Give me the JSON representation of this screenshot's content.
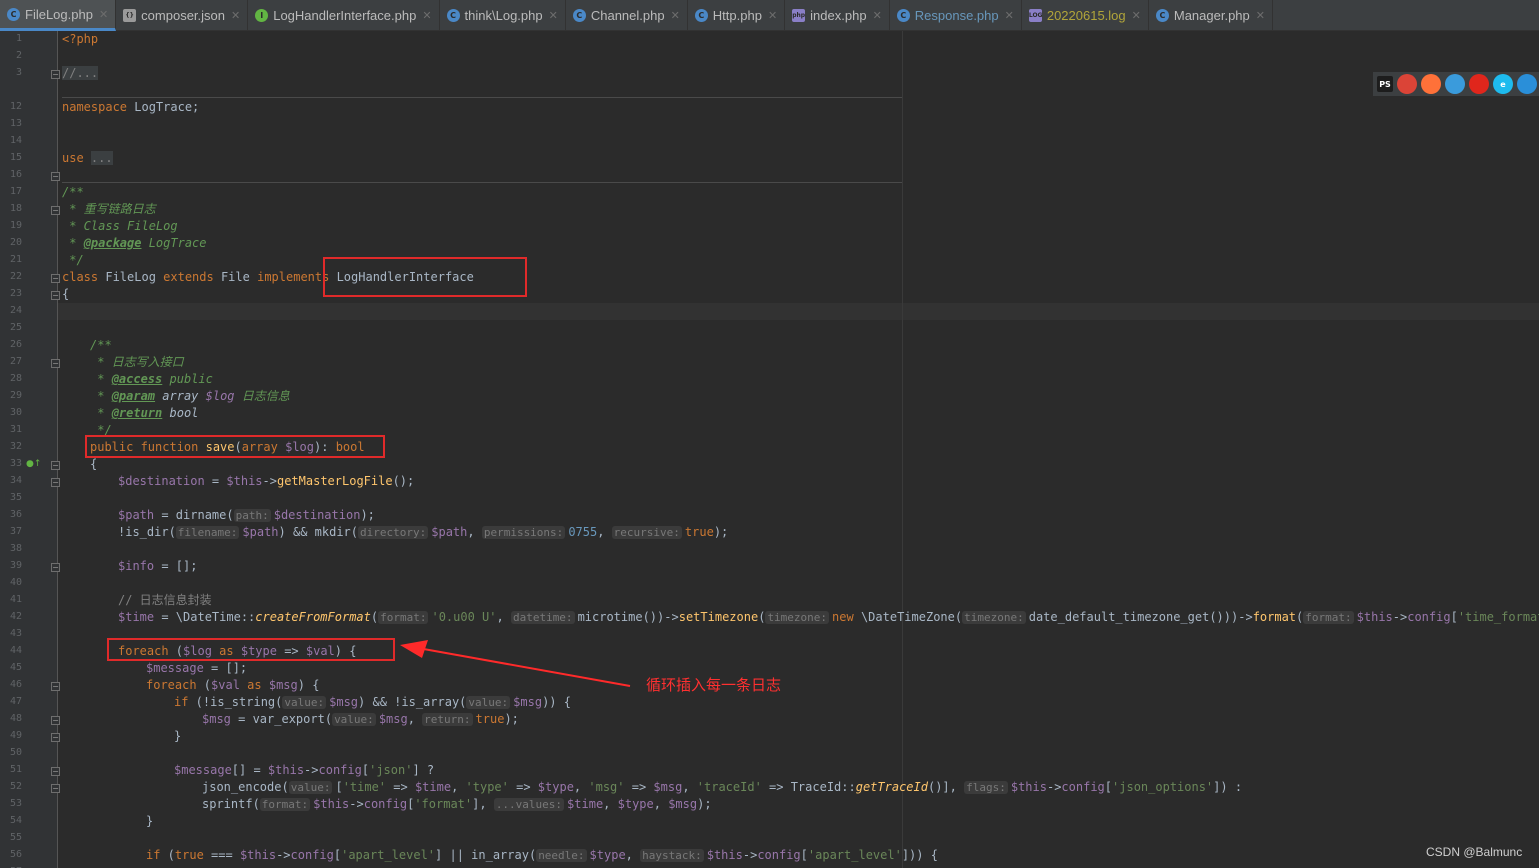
{
  "tabs": [
    {
      "label": "FileLog.php",
      "icon": "php-class-icon",
      "color": "#4a88c7",
      "glyph": "C",
      "active": true
    },
    {
      "label": "composer.json",
      "icon": "json-file-icon",
      "color": "#9a9a9a",
      "glyph": "{}",
      "active": false
    },
    {
      "label": "LogHandlerInterface.php",
      "icon": "php-interface-icon",
      "color": "#62b543",
      "glyph": "I",
      "active": false
    },
    {
      "label": "think\\Log.php",
      "icon": "php-class-icon",
      "color": "#4a88c7",
      "glyph": "C",
      "active": false
    },
    {
      "label": "Channel.php",
      "icon": "php-class-icon",
      "color": "#4a88c7",
      "glyph": "C",
      "active": false
    },
    {
      "label": "Http.php",
      "icon": "php-class-icon",
      "color": "#4a88c7",
      "glyph": "C",
      "active": false
    },
    {
      "label": "index.php",
      "icon": "php-file-icon",
      "color": "#8a7fc7",
      "glyph": "php",
      "active": false
    },
    {
      "label": "Response.php",
      "icon": "php-class-icon",
      "color": "#4a88c7",
      "glyph": "C",
      "active": false,
      "textColor": "#6897bb"
    },
    {
      "label": "20220615.log",
      "icon": "log-file-icon",
      "color": "#8a7fc7",
      "glyph": "LOG",
      "active": false,
      "textColor": "#b1a53a"
    },
    {
      "label": "Manager.php",
      "icon": "php-class-icon",
      "color": "#4a88c7",
      "glyph": "C",
      "active": false
    }
  ],
  "gutter": {
    "line_numbers": [
      "1",
      "2",
      "3",
      "12",
      "13",
      "14",
      "15",
      "16",
      "17",
      "18",
      "19",
      "20",
      "21",
      "22",
      "23",
      "24",
      "25",
      "26",
      "27",
      "28",
      "29",
      "30",
      "31",
      "32",
      "33",
      "34",
      "35",
      "36",
      "37",
      "38",
      "39",
      "40",
      "41",
      "42",
      "43",
      "44",
      "45",
      "46",
      "47",
      "48",
      "49",
      "50",
      "51",
      "52",
      "53",
      "54",
      "55",
      "56",
      "57",
      "58"
    ]
  },
  "code": {
    "l1": "<?php",
    "l3": "//...",
    "l13_kw": "namespace",
    "l13_rest": " LogTrace;",
    "l16_kw": "use",
    "l16_ph": "...",
    "l19": "/**",
    "l20": " * 重写链路日志",
    "l21": " * Class FileLog",
    "l22_a": " * ",
    "l22_tag": "@package",
    "l22_b": " LogTrace",
    "l23": " */",
    "l24_kw1": "class",
    "l24_a": " FileLog ",
    "l24_kw2": "extends",
    "l24_b": " File ",
    "l24_kw3": "implements",
    "l24_c": " LogHandlerInterface",
    "l25": "{",
    "l28": "/**",
    "l29": " * 日志写入接口",
    "l30_a": " * ",
    "l30_tag": "@access",
    "l30_b": " public",
    "l31_a": " * ",
    "l31_tag": "@param",
    "l31_b": " array ",
    "l31_var": "$log",
    "l31_c": " 日志信息",
    "l32_a": " * ",
    "l32_tag": "@return",
    "l32_b": " bool",
    "l33": " */",
    "l34_kw1": "public function ",
    "l34_fn": "save",
    "l34_a": "(",
    "l34_kw2": "array ",
    "l34_var": "$log",
    "l34_b": "): ",
    "l34_kw3": "bool",
    "l35": "{",
    "l36_var": "$destination",
    "l36_a": " = ",
    "l36_this": "$this",
    "l36_b": "->",
    "l36_fn": "getMasterLogFile",
    "l36_c": "();",
    "l38_var": "$path",
    "l38_a": " = dirname(",
    "l38_h": "path:",
    "l38_var2": "$destination",
    "l38_b": ");",
    "l39_a": "!is_dir(",
    "l39_h1": "filename:",
    "l39_v1": "$path",
    "l39_b": ") && mkdir(",
    "l39_h2": "directory:",
    "l39_v2": "$path",
    "l39_c": ", ",
    "l39_h3": "permissions:",
    "l39_num": "0755",
    "l39_d": ", ",
    "l39_h4": "recursive:",
    "l39_kw": "true",
    "l39_e": ");",
    "l41_var": "$info",
    "l41_a": " = [];",
    "l43": "// 日志信息封装",
    "l44_var": "$time",
    "l44_a": " = \\DateTime::",
    "l44_fn": "createFromFormat",
    "l44_b": "(",
    "l44_h1": "format:",
    "l44_s1": "'0.u00 U'",
    "l44_c": ", ",
    "l44_h2": "datetime:",
    "l44_d": "microtime())->",
    "l44_fn2": "setTimezone",
    "l44_e": "(",
    "l44_h3": "timezone:",
    "l44_kw": "new",
    "l44_f": " \\DateTimeZone(",
    "l44_h4": "timezone:",
    "l44_g": "date_default_timezone_get()))->",
    "l44_fn3": "format",
    "l44_h": "(",
    "l44_h5": "format:",
    "l44_this": "$this",
    "l44_i": "->",
    "l44_cfg": "config",
    "l44_j": "[",
    "l44_s2": "'time_format'",
    "l44_k": "]);",
    "l46_kw": "foreach",
    "l46_a": " (",
    "l46_v1": "$log",
    "l46_kw2": " as ",
    "l46_v2": "$type",
    "l46_b": " => ",
    "l46_v3": "$val",
    "l46_c": ") {",
    "l47_var": "$message",
    "l47_a": " = [];",
    "l48_kw": "foreach",
    "l48_a": " (",
    "l48_v1": "$val",
    "l48_kw2": " as ",
    "l48_v2": "$msg",
    "l48_b": ") {",
    "l49_kw": "if",
    "l49_a": " (!is_string(",
    "l49_h1": "value:",
    "l49_v1": "$msg",
    "l49_b": ") && !is_array(",
    "l49_h2": "value:",
    "l49_v2": "$msg",
    "l49_c": ")) {",
    "l50_var": "$msg",
    "l50_a": " = var_export(",
    "l50_h1": "value:",
    "l50_v2": "$msg",
    "l50_b": ", ",
    "l50_h2": "return:",
    "l50_kw": "true",
    "l50_c": ");",
    "l51": "}",
    "l53_var": "$message",
    "l53_a": "[] = ",
    "l53_this": "$this",
    "l53_b": "->",
    "l53_cfg": "config",
    "l53_c": "[",
    "l53_s": "'json'",
    "l53_d": "] ?",
    "l54_a": "json_encode(",
    "l54_h1": "value:",
    "l54_b": "[",
    "l54_s1": "'time'",
    "l54_c": " => ",
    "l54_v1": "$time",
    "l54_d": ", ",
    "l54_s2": "'type'",
    "l54_e": " => ",
    "l54_v2": "$type",
    "l54_f": ", ",
    "l54_s3": "'msg'",
    "l54_g": " => ",
    "l54_v3": "$msg",
    "l54_h": ", ",
    "l54_s4": "'traceId'",
    "l54_i": " => TraceId::",
    "l54_fn": "getTraceId",
    "l54_j": "()], ",
    "l54_h2": "flags:",
    "l54_this": "$this",
    "l54_k": "->",
    "l54_cfg": "config",
    "l54_l": "[",
    "l54_s5": "'json_options'",
    "l54_m": "]) :",
    "l55_a": "sprintf(",
    "l55_h1": "format:",
    "l55_this": "$this",
    "l55_b": "->",
    "l55_cfg": "config",
    "l55_c": "[",
    "l55_s": "'format'",
    "l55_d": "], ",
    "l55_h2": "...values:",
    "l55_v1": "$time",
    "l55_e": ", ",
    "l55_v2": "$type",
    "l55_f": ", ",
    "l55_v3": "$msg",
    "l55_g": ");",
    "l56": "}",
    "l58_kw": "if",
    "l58_a": " (",
    "l58_kw2": "true",
    "l58_b": " === ",
    "l58_this": "$this",
    "l58_c": "->",
    "l58_cfg": "config",
    "l58_d": "[",
    "l58_s1": "'apart_level'",
    "l58_e": "] || in_array(",
    "l58_h1": "needle:",
    "l58_v1": "$type",
    "l58_f": ", ",
    "l58_h2": "haystack:",
    "l58_this2": "$this",
    "l58_g": "->",
    "l58_cfg2": "config",
    "l58_h": "[",
    "l58_s2": "'apart_level'",
    "l58_i": "])) {"
  },
  "annotation": "循环插入每一条日志",
  "browsers": [
    {
      "name": "phpstorm-icon",
      "glyph": "PS",
      "color": "#1d1d1d"
    },
    {
      "name": "chrome-icon",
      "glyph": "",
      "color": "#db4437"
    },
    {
      "name": "firefox-icon",
      "glyph": "",
      "color": "#ff7139"
    },
    {
      "name": "safari-icon",
      "glyph": "",
      "color": "#3a9bdc"
    },
    {
      "name": "opera-icon",
      "glyph": "",
      "color": "#e0261c"
    },
    {
      "name": "ie-icon",
      "glyph": "e",
      "color": "#1ebbee"
    },
    {
      "name": "edge-icon",
      "glyph": "",
      "color": "#2a8fd9"
    }
  ],
  "watermark": "CSDN @Balmunc"
}
